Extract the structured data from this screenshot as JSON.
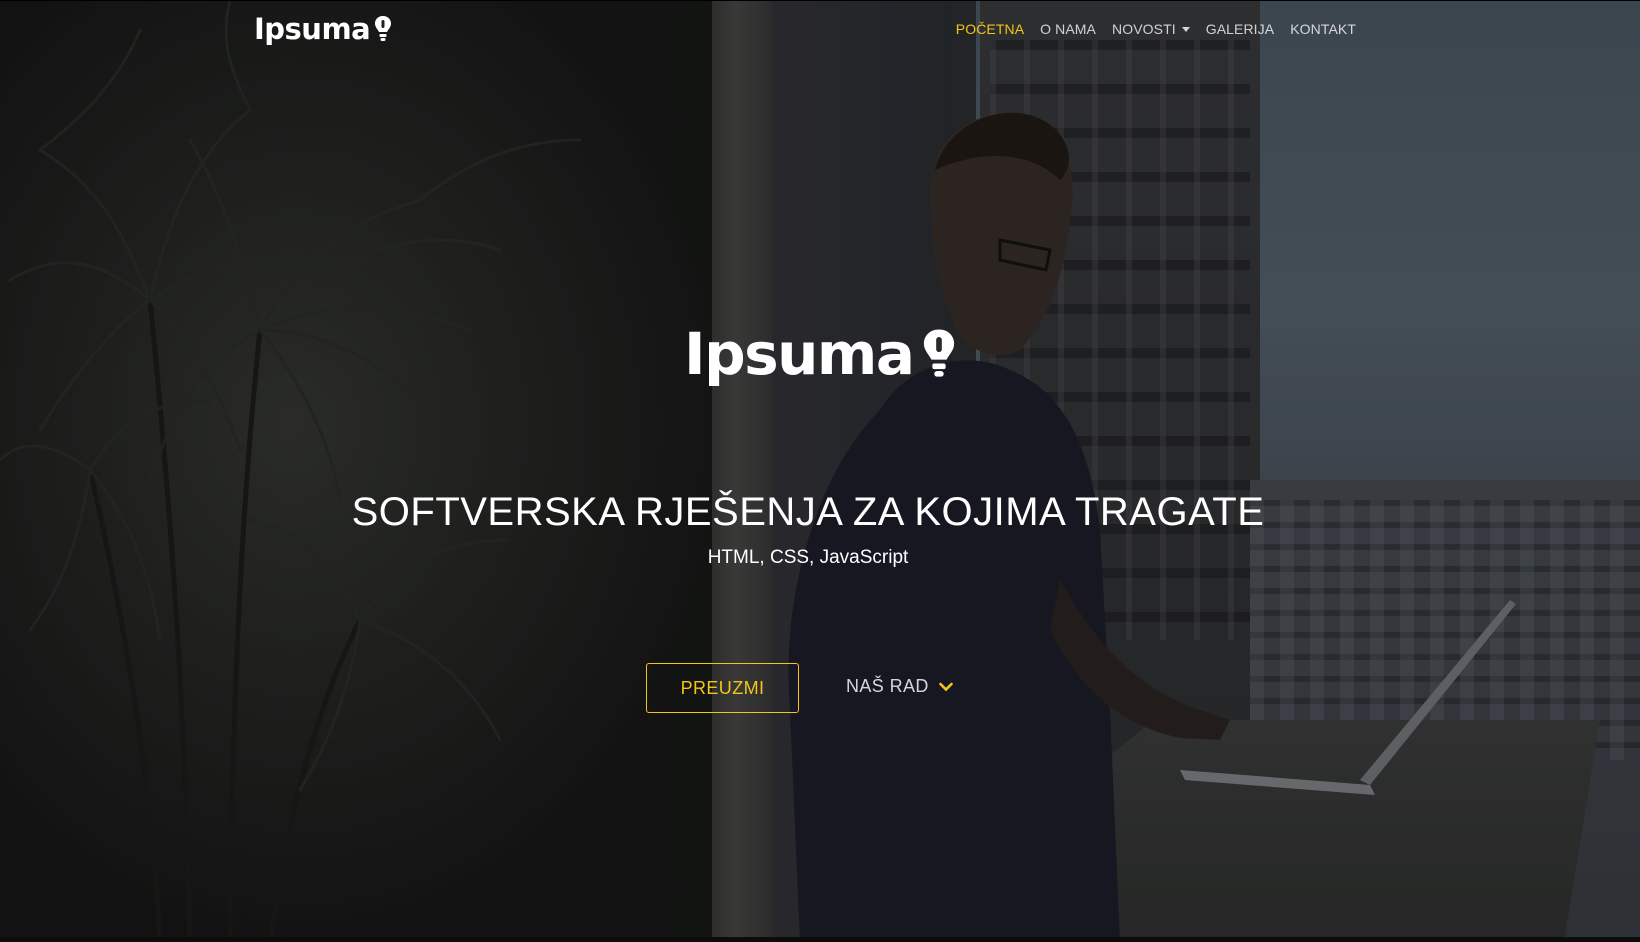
{
  "brand": {
    "name": "Ipsuma",
    "icon": "lightbulb-icon"
  },
  "nav": {
    "items": [
      {
        "label": "POČETNA",
        "active": true
      },
      {
        "label": "O NAMA",
        "active": false
      },
      {
        "label": "NOVOSTI",
        "active": false,
        "dropdown": true
      },
      {
        "label": "GALERIJA",
        "active": false
      },
      {
        "label": "KONTAKT",
        "active": false
      }
    ]
  },
  "hero": {
    "logo_text": "Ipsuma",
    "headline": "SOFTVERSKA RJEŠENJA ZA KOJIMA TRAGATE",
    "subline": "HTML, CSS, JavaScript",
    "primary_button": "PREUZMI",
    "secondary_button": "NAŠ RAD",
    "secondary_icon": "chevron-down-icon"
  },
  "colors": {
    "accent": "#f5c518",
    "text": "#ffffff"
  }
}
